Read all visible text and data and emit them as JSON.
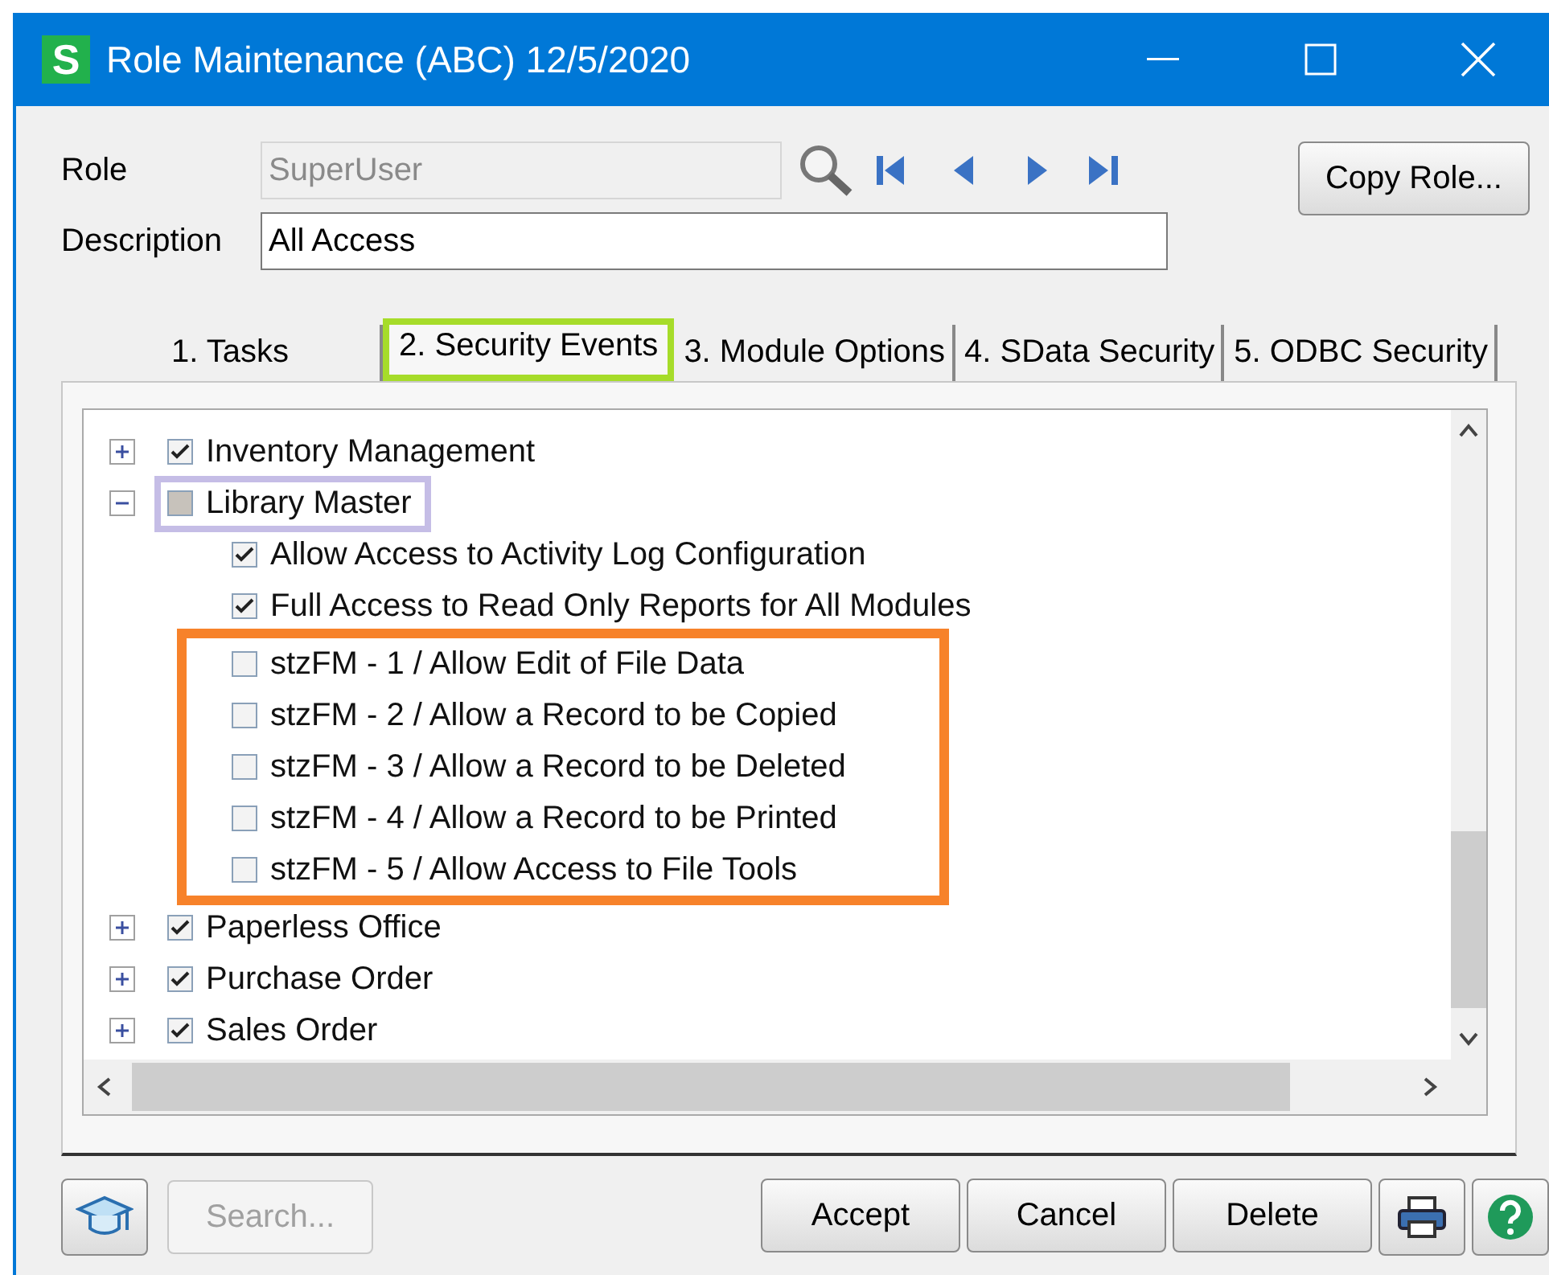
{
  "window": {
    "title": "Role Maintenance (ABC) 12/5/2020",
    "app_badge": "S"
  },
  "role": {
    "label": "Role",
    "value": "SuperUser",
    "disabled": true
  },
  "description": {
    "label": "Description",
    "value": "All Access"
  },
  "copy_button": "Copy Role...",
  "tabs": [
    {
      "label": "1. Tasks",
      "selected": false,
      "highlighted": false
    },
    {
      "label": "2. Security Events",
      "selected": true,
      "highlighted": true
    },
    {
      "label": "3. Module Options",
      "selected": false,
      "highlighted": false
    },
    {
      "label": "4. SData Security",
      "selected": false,
      "highlighted": false
    },
    {
      "label": "5. ODBC Security",
      "selected": false,
      "highlighted": false
    }
  ],
  "tree": [
    {
      "label": "Inventory Management",
      "checked": true,
      "partial": false,
      "expanded": false,
      "highlighted": false
    },
    {
      "label": "Library Master",
      "checked": false,
      "partial": true,
      "expanded": true,
      "highlighted": true,
      "children": [
        {
          "label": "Allow Access to Activity Log Configuration",
          "checked": true,
          "highlighted": false
        },
        {
          "label": "Full Access to Read Only Reports for All Modules",
          "checked": true,
          "highlighted": false
        },
        {
          "label": "stzFM - 1 / Allow Edit of File Data",
          "checked": false,
          "highlighted": true
        },
        {
          "label": "stzFM - 2 / Allow a Record to be Copied",
          "checked": false,
          "highlighted": true
        },
        {
          "label": "stzFM - 3 / Allow a Record to be Deleted",
          "checked": false,
          "highlighted": true
        },
        {
          "label": "stzFM - 4 / Allow a Record to be Printed",
          "checked": false,
          "highlighted": true
        },
        {
          "label": "stzFM - 5 / Allow Access to File Tools",
          "checked": false,
          "highlighted": true
        }
      ]
    },
    {
      "label": "Paperless Office",
      "checked": true,
      "partial": false,
      "expanded": false,
      "highlighted": false
    },
    {
      "label": "Purchase Order",
      "checked": true,
      "partial": false,
      "expanded": false,
      "highlighted": false
    },
    {
      "label": "Sales Order",
      "checked": true,
      "partial": false,
      "expanded": false,
      "highlighted": false
    }
  ],
  "search_button": {
    "label": "Search...",
    "disabled": true
  },
  "buttons": [
    {
      "label": "Accept"
    },
    {
      "label": "Cancel"
    },
    {
      "label": "Delete"
    }
  ]
}
